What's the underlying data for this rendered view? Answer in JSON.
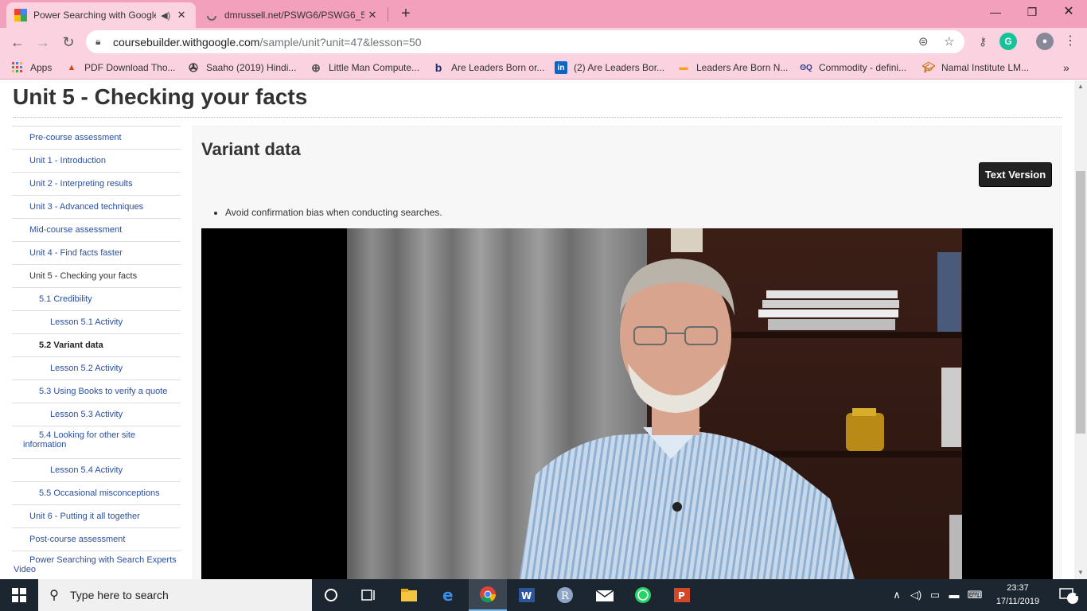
{
  "browser": {
    "tabs": [
      {
        "title": "Power Searching with Google",
        "active": true
      },
      {
        "title": "dmrussell.net/PSWG6/PSWG6_5.",
        "active": false
      }
    ],
    "url_host": "coursebuilder.withgoogle.com",
    "url_path": "/sample/unit?unit=47&lesson=50",
    "bookmarks": [
      {
        "label": "Apps",
        "icon": "apps-grid-icon"
      },
      {
        "label": "PDF Download Tho...",
        "icon": "pdf-icon"
      },
      {
        "label": "Saaho (2019) Hindi...",
        "icon": "film-reel-icon"
      },
      {
        "label": "Little Man Compute...",
        "icon": "globe-icon"
      },
      {
        "label": "Are Leaders Born or...",
        "icon": "bing-icon"
      },
      {
        "label": "(2) Are Leaders Bor...",
        "icon": "linkedin-icon"
      },
      {
        "label": "Leaders Are Born N...",
        "icon": "yahoo-icon"
      },
      {
        "label": "Commodity - defini...",
        "icon": "investopedia-icon"
      },
      {
        "label": "Namal Institute LM...",
        "icon": "graduation-cap-icon"
      }
    ],
    "bookmarks_overflow": "»"
  },
  "page": {
    "unit_title": "Unit 5 - Checking your facts",
    "nav_items": [
      {
        "label": "Pre-course assessment",
        "level": 0
      },
      {
        "label": "Unit 1 - Introduction",
        "level": 0
      },
      {
        "label": "Unit 2 - Interpreting results",
        "level": 0
      },
      {
        "label": "Unit 3 - Advanced techniques",
        "level": 0
      },
      {
        "label": "Mid-course assessment",
        "level": 0
      },
      {
        "label": "Unit 4 - Find facts faster",
        "level": 0
      },
      {
        "label": "Unit 5 - Checking your facts",
        "level": 0,
        "state": "current-unit"
      },
      {
        "label": "5.1 Credibility",
        "level": 1
      },
      {
        "label": "Lesson 5.1 Activity",
        "level": 2
      },
      {
        "label": "5.2 Variant data",
        "level": 1,
        "state": "current-lesson"
      },
      {
        "label": "Lesson 5.2 Activity",
        "level": 2
      },
      {
        "label": "5.3 Using Books to verify a quote",
        "level": 1
      },
      {
        "label": "Lesson 5.3 Activity",
        "level": 2
      },
      {
        "label": "5.4 Looking for other site information",
        "level": 1,
        "tall": true
      },
      {
        "label": "Lesson 5.4 Activity",
        "level": 2
      },
      {
        "label": "5.5 Occasional misconceptions",
        "level": 1
      },
      {
        "label": "Unit 6 - Putting it all together",
        "level": 0
      },
      {
        "label": "Post-course assessment",
        "level": 0
      },
      {
        "label": "Power Searching with Search Experts Video",
        "level": 0,
        "tall": true
      }
    ],
    "lesson_title": "Variant data",
    "text_version_button": "Text Version",
    "bullets": [
      "Avoid confirmation bias when conducting searches."
    ]
  },
  "taskbar": {
    "search_placeholder": "Type here to search",
    "time": "23:37",
    "date": "17/11/2019",
    "notification_count": "2",
    "apps": [
      "task-view-icon",
      "file-explorer-icon",
      "edge-icon",
      "chrome-icon",
      "word-icon",
      "r-icon",
      "mail-icon",
      "whatsapp-icon",
      "powerpoint-icon"
    ]
  },
  "colors": {
    "chrome_tabbar": "#f3a0bd",
    "chrome_toolbar": "#fbd3e0",
    "link": "#2a4fa0",
    "taskbar": "#1c2631"
  }
}
